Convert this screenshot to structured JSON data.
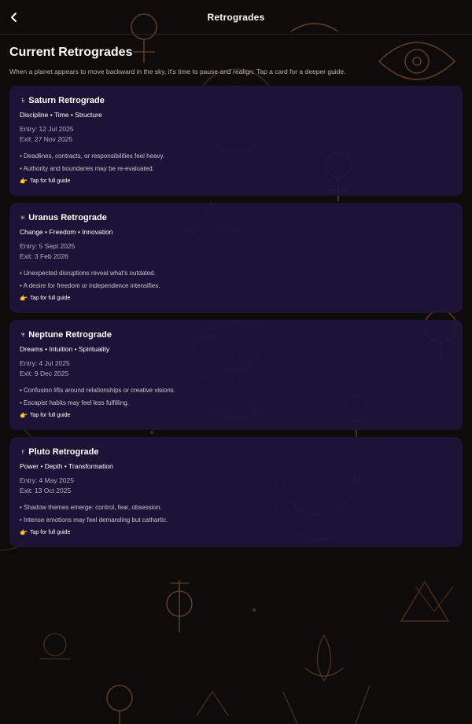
{
  "header": {
    "title": "Retrogrades",
    "back_icon": "chevron-left-icon"
  },
  "main": {
    "title": "Current Retrogrades",
    "intro": "When a planet appears to move backward in the sky, it's time to pause and realign. Tap a card for a deeper guide."
  },
  "cards": [
    {
      "symbol": "♄",
      "name": "Saturn Retrograde",
      "themes": "Discipline • Time • Structure",
      "entry": "Entry: 12 Jul 2025",
      "exit": "Exit: 27 Nov 2025",
      "bullets": [
        "• Deadlines, contracts, or responsibilities feel heavy.",
        "• Authority and boundaries may be re-evaluated."
      ],
      "tap_label": "Tap for full guide"
    },
    {
      "symbol": "♅",
      "name": "Uranus Retrograde",
      "themes": "Change • Freedom • Innovation",
      "entry": "Entry: 5 Sept 2025",
      "exit": "Exit: 3 Feb 2026",
      "bullets": [
        "• Unexpected disruptions reveal what's outdated.",
        "• A desire for freedom or independence intensifies."
      ],
      "tap_label": "Tap for full guide"
    },
    {
      "symbol": "♆",
      "name": "Neptune Retrograde",
      "themes": "Dreams • Intuition • Spirituality",
      "entry": "Entry: 4 Jul 2025",
      "exit": "Exit: 9 Dec 2025",
      "bullets": [
        "• Confusion lifts around relationships or creative visions.",
        "• Escapist habits may feel less fulfilling."
      ],
      "tap_label": "Tap for full guide"
    },
    {
      "symbol": "♇",
      "name": "Pluto Retrograde",
      "themes": "Power • Depth • Transformation",
      "entry": "Entry: 4 May 2025",
      "exit": "Exit: 13 Oct 2025",
      "bullets": [
        "• Shadow themes emerge: control, fear, obsession.",
        "• Intense emotions may feel demanding but cathartic."
      ],
      "tap_label": "Tap for full guide"
    }
  ],
  "colors": {
    "background": "#0e0c0b",
    "card": "#1c163a",
    "ornament": "#7a4e2c",
    "text_muted": "#b4afbf"
  },
  "icons": {
    "tap": "pointing-hand-icon",
    "background": "astrology-ornaments"
  }
}
